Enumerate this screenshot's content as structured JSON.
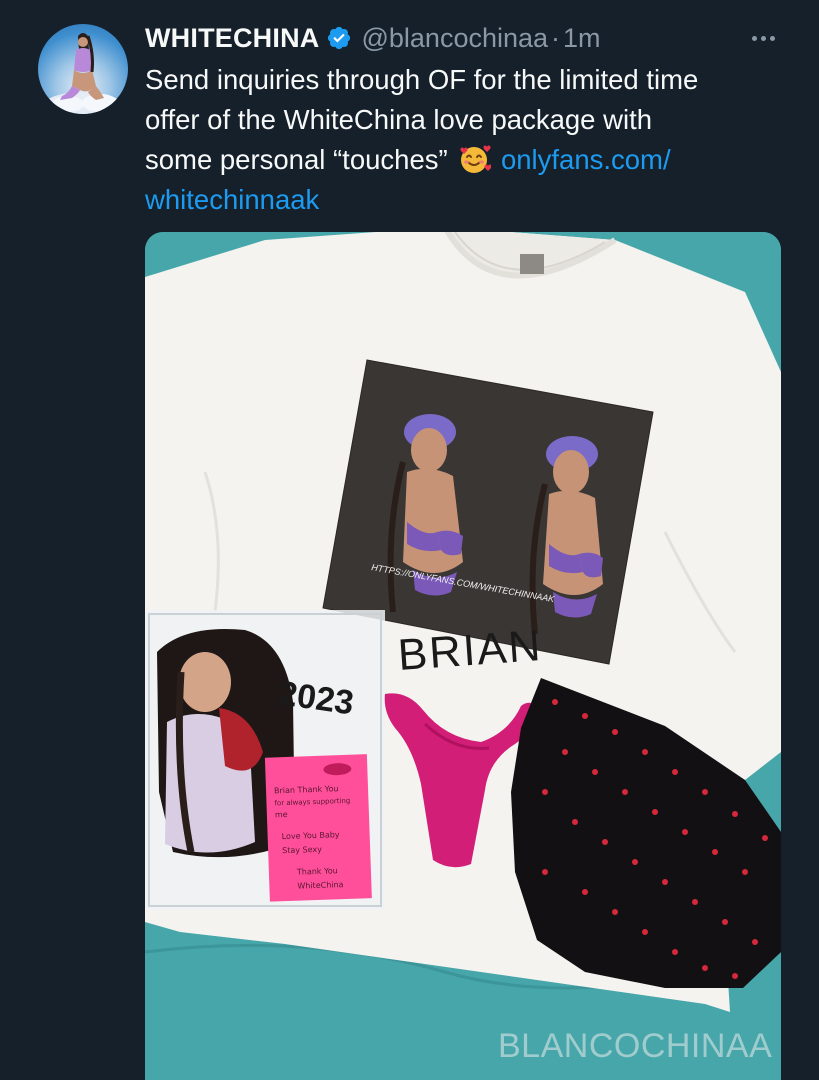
{
  "tweet": {
    "display_name": "WHITECHINA",
    "handle": "@blancochinaa",
    "separator": "·",
    "time": "1m",
    "text_line1": "Send inquiries through OF for the limited time",
    "text_line2": "offer of the WhiteChina love package with",
    "text_line3": "some personal “touches”",
    "link_part1": "onlyfans.com/",
    "link_part2": "whitechinnaak"
  },
  "media": {
    "shirt_print_caption": "HTTPS://ONLYFANS.COM/WHITECHINNAAK",
    "marker_text": "BRIAN",
    "sticker_text": "2023",
    "note_lines": [
      "Brian Thank You",
      "for always supporting",
      "me",
      "Love You Baby",
      "Stay Sexy",
      "Thank You",
      "WhiteChina"
    ]
  },
  "watermark": "BLANCOCHINAA",
  "colors": {
    "background": "#15202b",
    "text": "#f7f9f9",
    "secondary": "#8b98a5",
    "link": "#1d9bf0",
    "verified": "#1d9bf0"
  },
  "icons": {
    "verified": "verified-badge-icon",
    "more": "more-horizontal-icon",
    "emoji": "smiling-face-with-hearts-emoji"
  }
}
